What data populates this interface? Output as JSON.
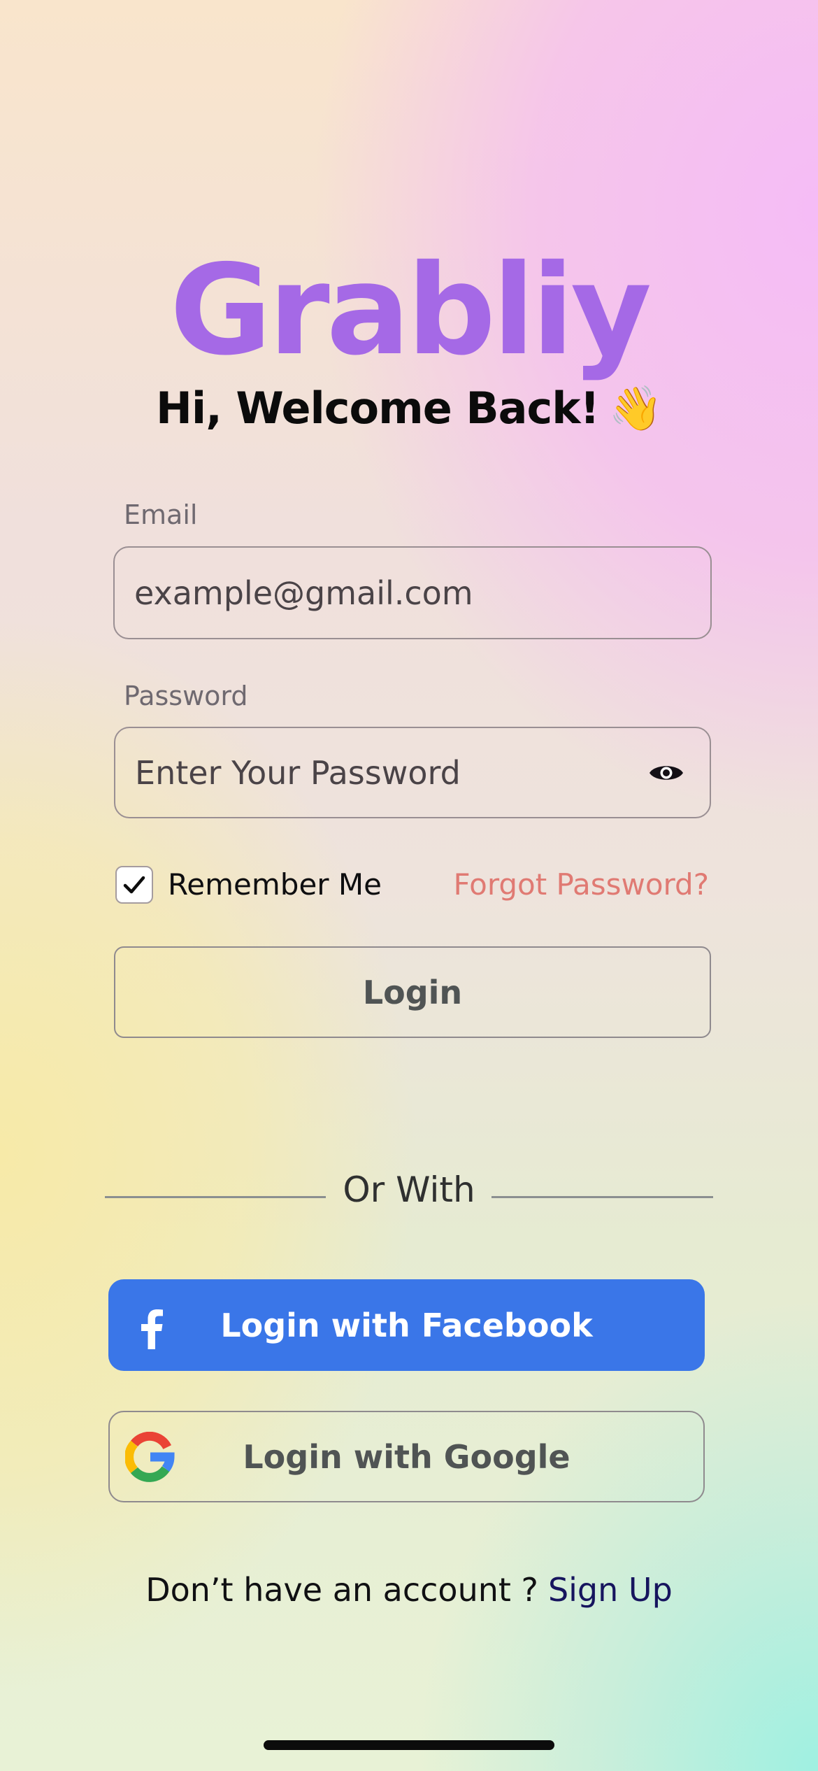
{
  "app": {
    "brand": "Grabliy",
    "welcome": "Hi, Welcome Back!",
    "welcome_emoji": "👋"
  },
  "form": {
    "email_label": "Email",
    "email_placeholder": "example@gmail.com",
    "password_label": "Password",
    "password_placeholder": "Enter Your Password",
    "remember_label": "Remember Me",
    "remember_checked": true,
    "forgot_label": "Forgot Password?",
    "login_label": "Login"
  },
  "divider": {
    "label": "Or With"
  },
  "social": {
    "facebook_label": "Login with Facebook",
    "google_label": "Login with Google"
  },
  "footer": {
    "question": "Don’t have an account ?",
    "signup_label": "Sign Up"
  },
  "colors": {
    "brand": "#a569e6",
    "facebook": "#3a76e8",
    "forgot": "#e07a73",
    "signup_link": "#16145e"
  },
  "icons": {
    "password_toggle": "eye-icon",
    "remember_check": "checkmark-icon",
    "facebook": "facebook-icon",
    "google": "google-icon"
  }
}
